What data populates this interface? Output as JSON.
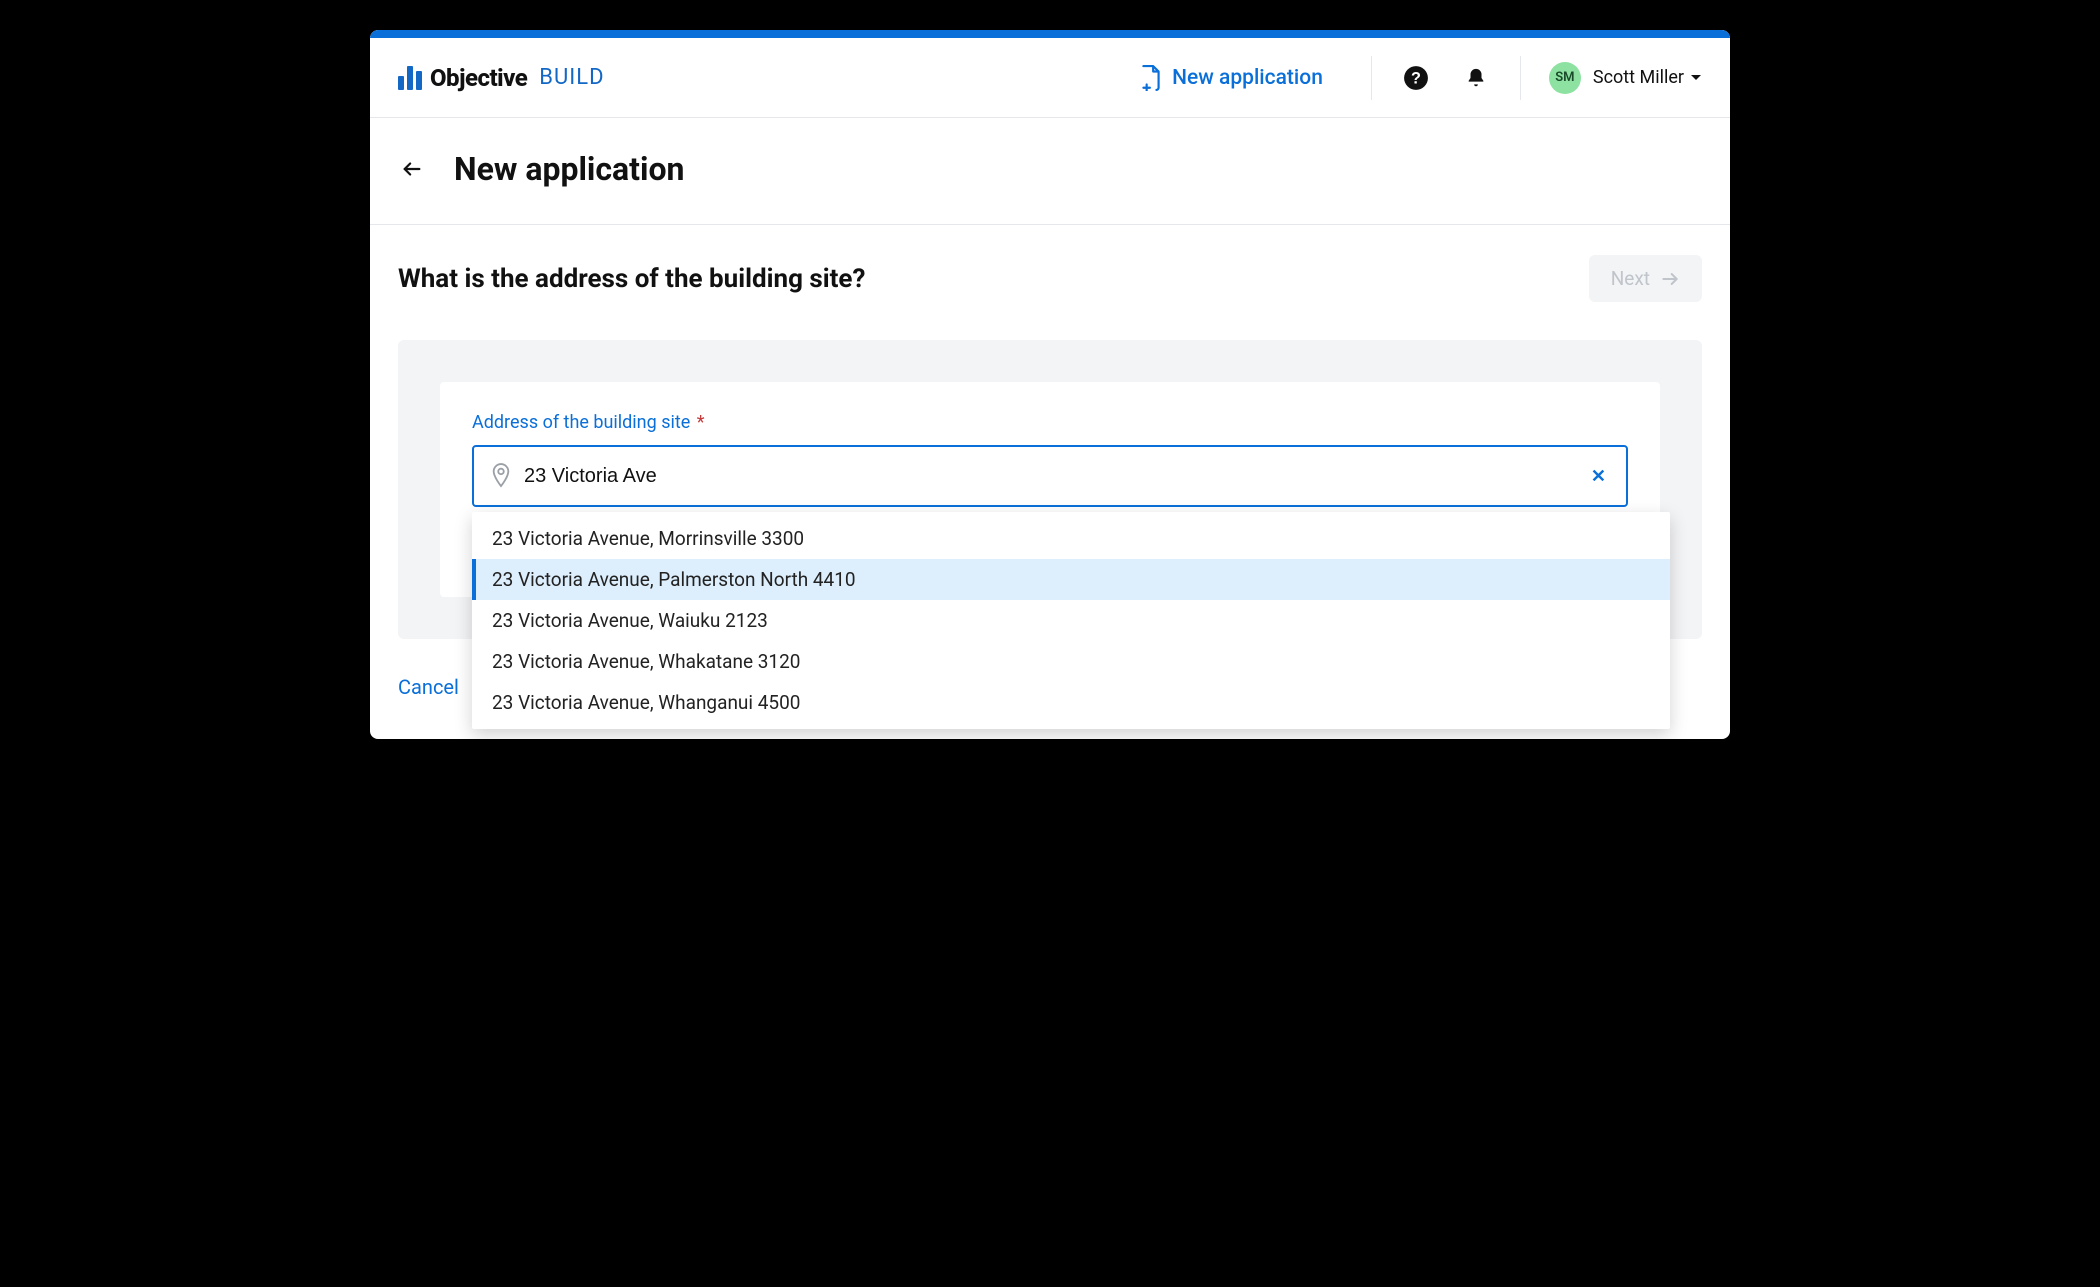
{
  "brand": {
    "word1": "Objective",
    "word2": "BUILD"
  },
  "header": {
    "new_app_link": "New application",
    "user_initials": "SM",
    "user_name": "Scott Miller"
  },
  "page": {
    "title": "New application",
    "question": "What is the address of the building site?",
    "next_label": "Next",
    "cancel_label": "Cancel"
  },
  "form": {
    "address_label": "Address of the building site",
    "required_mark": "*",
    "address_value": "23 Victoria Ave",
    "clear_symbol": "✕",
    "suggestions": [
      "23 Victoria Avenue, Morrinsville 3300",
      "23 Victoria Avenue, Palmerston North 4410",
      "23 Victoria Avenue, Waiuku 2123",
      "23 Victoria Avenue, Whakatane 3120",
      "23 Victoria Avenue, Whanganui 4500"
    ],
    "highlighted_index": 1
  }
}
